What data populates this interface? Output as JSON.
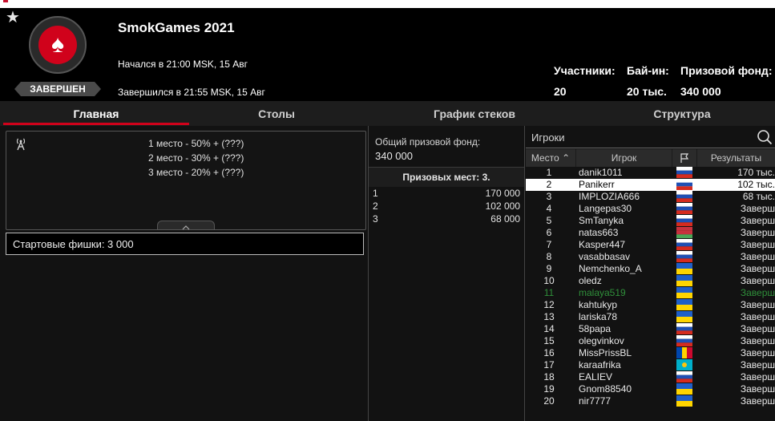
{
  "header": {
    "title": "SmokGames 2021",
    "status": "ЗАВЕРШЕН",
    "started": "Начался в 21:00 MSK, 15 Авг",
    "ended": "Завершился в 21:55 MSK, 15 Авг",
    "stats": [
      {
        "label": "Участники:",
        "value": "20"
      },
      {
        "label": "Бай-ин:",
        "value": "20 тыс."
      },
      {
        "label": "Призовой фонд:",
        "value": "340 000"
      }
    ]
  },
  "tabs": [
    {
      "label": "Главная",
      "active": true
    },
    {
      "label": "Столы",
      "active": false
    },
    {
      "label": "График стеков",
      "active": false
    },
    {
      "label": "Структура",
      "active": false
    }
  ],
  "payouts": [
    "1 место - 50% + (???)",
    "2 место - 30% + (???)",
    "3 место - 20% + (???)"
  ],
  "starting_chips": "Стартовые фишки:  3 000",
  "prize_pool": {
    "label": "Общий призовой фонд:",
    "value": "340 000",
    "places_header": "Призовых мест: 3.",
    "places": [
      {
        "place": "1",
        "amount": "170 000"
      },
      {
        "place": "2",
        "amount": "102 000"
      },
      {
        "place": "3",
        "amount": "68 000"
      }
    ]
  },
  "players": {
    "search_label": "Игроки",
    "columns": {
      "place": "Место",
      "player": "Игрок",
      "results": "Результаты"
    },
    "rows": [
      {
        "place": "1",
        "name": "danik1011",
        "flag": "ru",
        "result": "170 тыс."
      },
      {
        "place": "2",
        "name": "Panikerr",
        "flag": "ru",
        "result": "102 тыс.",
        "highlight": true
      },
      {
        "place": "3",
        "name": "IMPLOZIA666",
        "flag": "ru",
        "result": "68 тыс."
      },
      {
        "place": "4",
        "name": "Langepas30",
        "flag": "ru",
        "result": "Заверш"
      },
      {
        "place": "5",
        "name": "SmTanyka",
        "flag": "ru",
        "result": "Заверш"
      },
      {
        "place": "6",
        "name": "natas663",
        "flag": "by",
        "result": "Заверш"
      },
      {
        "place": "7",
        "name": "Kasper447",
        "flag": "ru",
        "result": "Заверш"
      },
      {
        "place": "8",
        "name": "vasabbasav",
        "flag": "ru",
        "result": "Заверш"
      },
      {
        "place": "9",
        "name": "Nemchenko_A",
        "flag": "ua",
        "result": "Заверш"
      },
      {
        "place": "10",
        "name": "oledz",
        "flag": "ua",
        "result": "Заверш"
      },
      {
        "place": "11",
        "name": "malaya519",
        "flag": "ua",
        "result": "Заверш",
        "green": true
      },
      {
        "place": "12",
        "name": "kahtukyp",
        "flag": "ua",
        "result": "Заверш"
      },
      {
        "place": "13",
        "name": "lariska78",
        "flag": "ua",
        "result": "Заверш"
      },
      {
        "place": "14",
        "name": "58papa",
        "flag": "ru",
        "result": "Заверш"
      },
      {
        "place": "15",
        "name": "olegvinkov",
        "flag": "ru",
        "result": "Заверш"
      },
      {
        "place": "16",
        "name": "MissPrissBL",
        "flag": "md",
        "result": "Заверш"
      },
      {
        "place": "17",
        "name": "karaafrika",
        "flag": "kz",
        "result": "Заверш"
      },
      {
        "place": "18",
        "name": "EALIEV",
        "flag": "ru",
        "result": "Заверш"
      },
      {
        "place": "19",
        "name": "Gnom88540",
        "flag": "ua",
        "result": "Заверш"
      },
      {
        "place": "20",
        "name": "nir7777",
        "flag": "ua",
        "result": "Заверш"
      }
    ]
  },
  "colors": {
    "header_bg": "#000000",
    "accent_red": "#d0021b",
    "panel_bg": "#121212",
    "highlight_row": "#ffffff",
    "green_text": "#2f8f3a"
  }
}
